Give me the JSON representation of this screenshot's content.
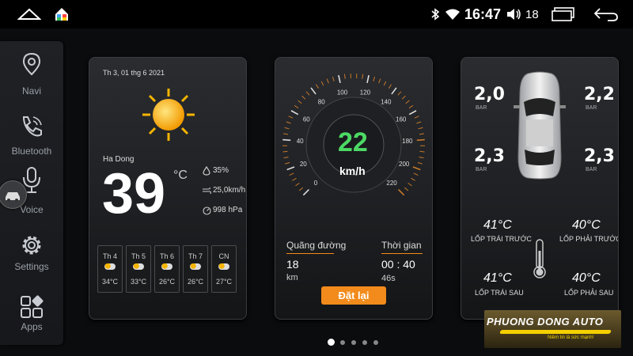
{
  "status_bar": {
    "time": "16:47",
    "volume_level": "18"
  },
  "sidebar": {
    "items": [
      {
        "label": "Navi",
        "icon": "map-pin-icon"
      },
      {
        "label": "Bluetooth",
        "icon": "phone-icon"
      },
      {
        "label": "Voice",
        "icon": "voice-icon"
      },
      {
        "label": "Settings",
        "icon": "gear-icon"
      },
      {
        "label": "Apps",
        "icon": "apps-grid-icon"
      }
    ]
  },
  "weather": {
    "date": "Th 3, 01 thg 6 2021",
    "location": "Ha Dong",
    "temperature": "39",
    "unit": "°C",
    "humidity": "35%",
    "wind": "25,0km/h",
    "pressure": "998 hPa",
    "forecast": [
      {
        "day": "Th 4",
        "temp": "34°C"
      },
      {
        "day": "Th 5",
        "temp": "33°C"
      },
      {
        "day": "Th 6",
        "temp": "26°C"
      },
      {
        "day": "Th 7",
        "temp": "26°C"
      },
      {
        "day": "CN",
        "temp": "27°C"
      }
    ]
  },
  "speedometer": {
    "speed": "22",
    "unit": "km/h",
    "ticks": [
      "0",
      "20",
      "40",
      "60",
      "80",
      "100",
      "120",
      "140",
      "160",
      "180",
      "200",
      "220"
    ],
    "distance_label": "Quãng đường",
    "distance_value": "18",
    "distance_unit": "km",
    "time_label": "Thời gian",
    "time_value": "00 : 40",
    "time_seconds": "46s",
    "reset_label": "Đặt lại"
  },
  "tires": {
    "unit": "BAR",
    "front_left": {
      "pressure": "2,0",
      "temp": "41°C",
      "label": "LỐP TRÁI TRƯỚC"
    },
    "front_right": {
      "pressure": "2,2",
      "temp": "40°C",
      "label": "LỐP PHẢI TRƯỚC"
    },
    "rear_left": {
      "pressure": "2,3",
      "temp": "41°C",
      "label": "LỐP TRÁI SAU"
    },
    "rear_right": {
      "pressure": "2,3",
      "temp": "40°C",
      "label": "LỐP PHẢI SAU"
    }
  },
  "watermark": {
    "brand": "PHUONG DONG AUTO",
    "slogan": "Niềm tin là sức mạnh!"
  },
  "pager": {
    "pages": 5,
    "active": 0
  },
  "colors": {
    "accent_orange": "#f28b1b",
    "speed_green": "#4cd964",
    "sun_yellow": "#f5b400"
  }
}
